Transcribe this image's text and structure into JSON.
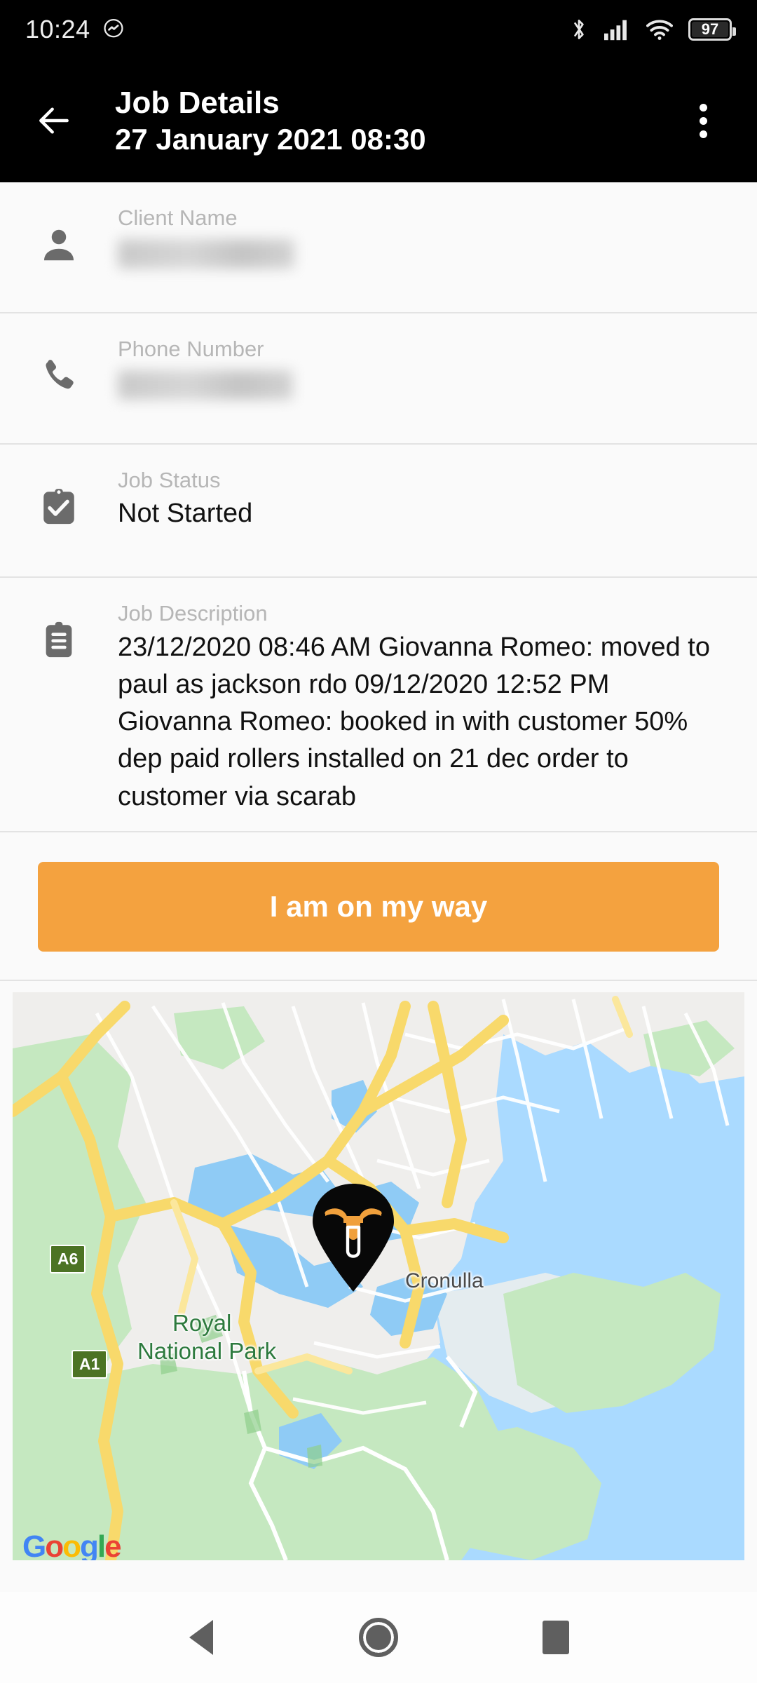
{
  "status_bar": {
    "time": "10:24",
    "notification_icon": "activity-bubble-icon",
    "icons": [
      "bluetooth-icon",
      "cellular-signal-icon",
      "wifi-icon"
    ],
    "battery_percent": "97"
  },
  "app_bar": {
    "back_icon": "back-arrow-icon",
    "title": "Job Details",
    "subtitle": "27 January 2021 08:30",
    "overflow_icon": "more-vertical-icon"
  },
  "fields": [
    {
      "icon": "person-icon",
      "label": "Client Name",
      "value": "",
      "redacted": true
    },
    {
      "icon": "phone-icon",
      "label": "Phone Number",
      "value": "",
      "redacted": true
    },
    {
      "icon": "clipboard-check-icon",
      "label": "Job Status",
      "value": "Not Started",
      "redacted": false
    },
    {
      "icon": "clipboard-text-icon",
      "label": "Job Description",
      "value": "23/12/2020 08:46 AM Giovanna Romeo: moved to paul as jackson rdo 09/12/2020 12:52 PM Giovanna Romeo: booked in with customer 50% dep paid rollers installed on 21 dec order to customer via scarab",
      "redacted": false
    }
  ],
  "cta": {
    "label": "I am on my way",
    "color": "#f4a23f"
  },
  "map": {
    "provider_logo": "Google",
    "pin_icon": "bull-head-map-pin",
    "labels": [
      {
        "text": "Cronulla",
        "type": "place"
      },
      {
        "text": "Royal",
        "type": "park"
      },
      {
        "text": "National Park",
        "type": "park"
      }
    ],
    "road_badges": [
      "A6",
      "A1"
    ],
    "colors": {
      "water": "#aadaff",
      "park": "#c5e8c0",
      "road": "#f8d96b",
      "land": "#efeeec"
    }
  },
  "nav_bar": {
    "back": "nav-back-icon",
    "home": "nav-home-icon",
    "recents": "nav-recents-icon"
  }
}
